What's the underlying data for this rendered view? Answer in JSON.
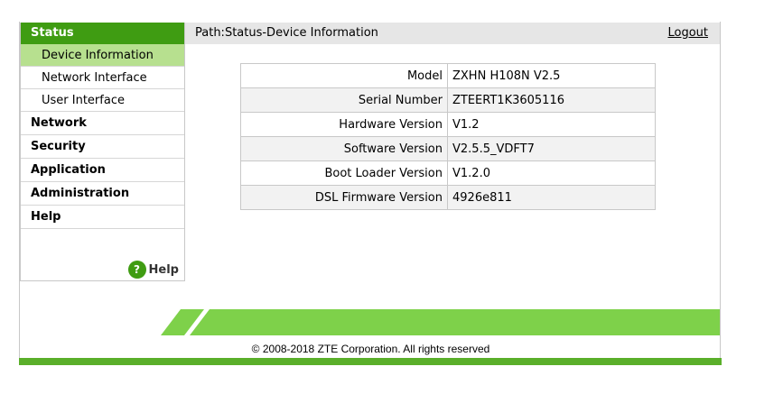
{
  "sidebar": {
    "status": {
      "label": "Status",
      "items": [
        {
          "label": "Device Information"
        },
        {
          "label": "Network Interface"
        },
        {
          "label": "User Interface"
        }
      ]
    },
    "sections": [
      {
        "label": "Network"
      },
      {
        "label": "Security"
      },
      {
        "label": "Application"
      },
      {
        "label": "Administration"
      },
      {
        "label": "Help"
      }
    ],
    "help_icon": "?",
    "help_label": "Help"
  },
  "header": {
    "path": "Path:Status-Device Information",
    "logout": "Logout"
  },
  "device_info": {
    "rows": [
      {
        "label": "Model",
        "value": "ZXHN H108N V2.5"
      },
      {
        "label": "Serial Number",
        "value": "ZTEERT1K3605116"
      },
      {
        "label": "Hardware Version",
        "value": "V1.2"
      },
      {
        "label": "Software Version",
        "value": "V2.5.5_VDFT7"
      },
      {
        "label": "Boot Loader Version",
        "value": "V1.2.0"
      },
      {
        "label": "DSL Firmware Version",
        "value": "4926e811"
      }
    ]
  },
  "footer": {
    "copyright": "© 2008-2018 ZTE Corporation. All rights reserved"
  },
  "colors": {
    "accent_green": "#3f9c12",
    "selected_green": "#b7e08f",
    "band_green": "#7ed14a"
  }
}
